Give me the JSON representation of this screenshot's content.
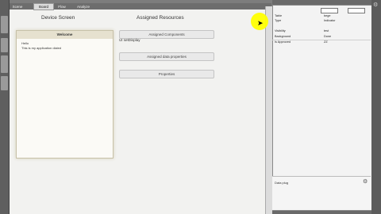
{
  "tabs": [
    "Scene",
    "Board",
    "Flow",
    "Analyze"
  ],
  "active_tab": "Board",
  "device_screen": {
    "title": "Device Screen",
    "header": "Welcome",
    "lines": [
      "Hello",
      "This is my application dialed"
    ]
  },
  "assigned_resources": {
    "title": "Assigned Resources",
    "buttons": [
      "Assigned Components",
      "Assigned data properties",
      "Properties"
    ],
    "items": [
      "UI setDisplay"
    ]
  },
  "properties": {
    "rows": [
      {
        "key": "Table",
        "value": "bege"
      },
      {
        "key": "Type",
        "value": "Indicator"
      },
      {
        "key": "Visibility",
        "value": "test"
      },
      {
        "key": "Background",
        "value": "Done"
      },
      {
        "key": "Is Approved",
        "value": "ZZ"
      }
    ]
  },
  "bottom_panel": {
    "label": "Data plug"
  },
  "colors": {
    "highlight": "#3b7fc9",
    "cursor_ring": "#ffff00"
  }
}
